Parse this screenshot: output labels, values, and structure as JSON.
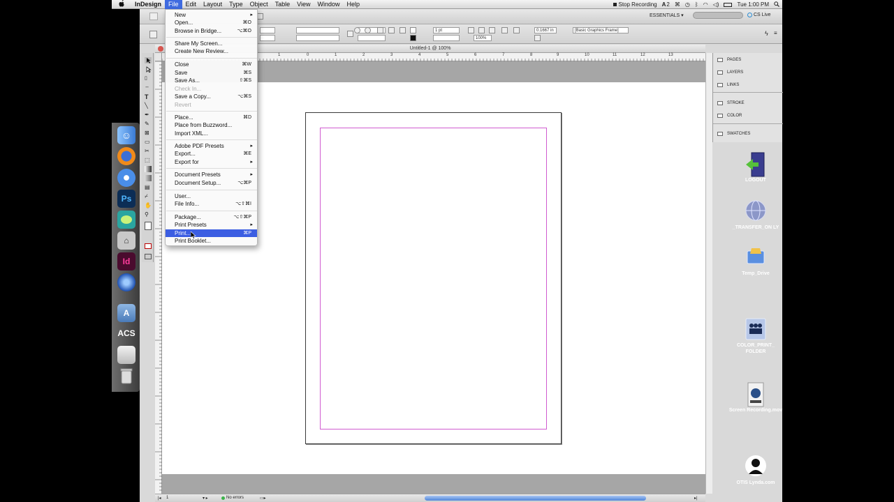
{
  "menubar": {
    "apple": "",
    "app_name": "InDesign",
    "items": [
      "File",
      "Edit",
      "Layout",
      "Type",
      "Object",
      "Table",
      "View",
      "Window",
      "Help"
    ],
    "status": {
      "recording": "Stop Recording",
      "adobe": "2",
      "clock": "Tue 1:00 PM"
    }
  },
  "app": {
    "workspace": "ESSENTIALS",
    "cs_live": "CS Live",
    "doc_title": "Untitled-1 @ 100%",
    "control": {
      "stroke_weight": "1 pt",
      "zoom": "100%",
      "measure": "0.1667 in",
      "frame_style": "[Basic Graphics Frame]"
    },
    "ruler_labels": [
      "1",
      "0",
      "1",
      "2",
      "3",
      "4",
      "5",
      "6",
      "7",
      "8",
      "9",
      "10",
      "11",
      "12",
      "13"
    ],
    "status_bar": {
      "page": "1",
      "errors": "No errors"
    }
  },
  "panels": [
    {
      "label": "PAGES"
    },
    {
      "label": "LAYERS"
    },
    {
      "label": "LINKS"
    },
    {
      "label": "STROKE"
    },
    {
      "label": "COLOR"
    },
    {
      "label": "SWATCHES"
    }
  ],
  "dock": {
    "acs_label": "ACS"
  },
  "desktop": [
    {
      "label": "LOGOUT",
      "icon": "logout-icon"
    },
    {
      "label": "_TRANSFER_ON LY",
      "icon": "network-globe-icon"
    },
    {
      "label": "Temp_Drive",
      "icon": "drive-icon"
    },
    {
      "label": "COLOR_PRINT_ FOLDER",
      "icon": "shared-folder-icon"
    },
    {
      "label": "Screen Recording.mov",
      "icon": "movie-file-icon"
    },
    {
      "label": "OTIS Lynda.com",
      "icon": "otis-avatar-icon"
    }
  ],
  "file_menu": {
    "items": [
      {
        "label": "New",
        "shortcut": "",
        "submenu": true
      },
      {
        "label": "Open...",
        "shortcut": "⌘O"
      },
      {
        "label": "Browse in Bridge...",
        "shortcut": "⌥⌘O"
      },
      {
        "label": "Share My Screen...",
        "shortcut": ""
      },
      {
        "label": "Create New Review...",
        "shortcut": ""
      },
      {
        "label": "Close",
        "shortcut": "⌘W"
      },
      {
        "label": "Save",
        "shortcut": "⌘S"
      },
      {
        "label": "Save As...",
        "shortcut": "⇧⌘S"
      },
      {
        "label": "Check In...",
        "shortcut": "",
        "disabled": true
      },
      {
        "label": "Save a Copy...",
        "shortcut": "⌥⌘S"
      },
      {
        "label": "Revert",
        "shortcut": "",
        "disabled": true
      },
      {
        "label": "Place...",
        "shortcut": "⌘D"
      },
      {
        "label": "Place from Buzzword...",
        "shortcut": ""
      },
      {
        "label": "Import XML...",
        "shortcut": ""
      },
      {
        "label": "Adobe PDF Presets",
        "shortcut": "",
        "submenu": true
      },
      {
        "label": "Export...",
        "shortcut": "⌘E"
      },
      {
        "label": "Export for",
        "shortcut": "",
        "submenu": true
      },
      {
        "label": "Document Presets",
        "shortcut": "",
        "submenu": true
      },
      {
        "label": "Document Setup...",
        "shortcut": "⌥⌘P"
      },
      {
        "label": "User...",
        "shortcut": ""
      },
      {
        "label": "File Info...",
        "shortcut": "⌥⇧⌘I"
      },
      {
        "label": "Package...",
        "shortcut": "⌥⇧⌘P"
      },
      {
        "label": "Print Presets",
        "shortcut": "",
        "submenu": true
      },
      {
        "label": "Print...",
        "shortcut": "⌘P",
        "selected": true
      },
      {
        "label": "Print Booklet...",
        "shortcut": ""
      }
    ]
  },
  "colors": {
    "menu_highlight": "#3c5ee2",
    "margin_guide": "#d05ad0"
  }
}
